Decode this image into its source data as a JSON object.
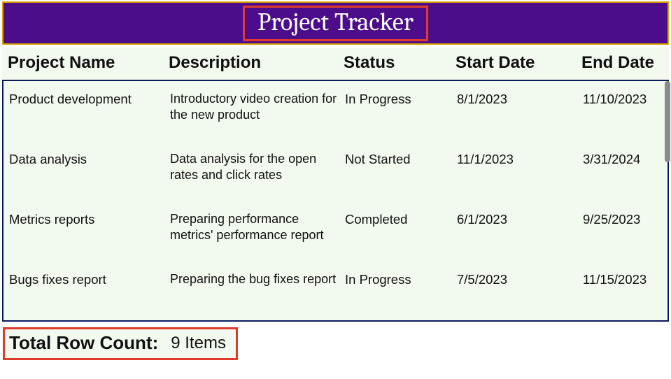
{
  "header": {
    "title": "Project Tracker"
  },
  "columns": {
    "name": "Project Name",
    "desc": "Description",
    "status": "Status",
    "start": "Start Date",
    "end": "End Date"
  },
  "rows": [
    {
      "name": "Product development",
      "desc": "Introductory video creation for the new product",
      "status": "In Progress",
      "start": "8/1/2023",
      "end": "11/10/2023"
    },
    {
      "name": "Data analysis",
      "desc": "Data analysis for the open rates and click rates",
      "status": "Not Started",
      "start": "11/1/2023",
      "end": "3/31/2024"
    },
    {
      "name": "Metrics reports",
      "desc": "Preparing performance metrics' performance report",
      "status": "Completed",
      "start": "6/1/2023",
      "end": "9/25/2023"
    },
    {
      "name": "Bugs fixes report",
      "desc": "Preparing the bug fixes report",
      "status": "In Progress",
      "start": "7/5/2023",
      "end": "11/15/2023"
    }
  ],
  "footer": {
    "label": "Total Row Count:",
    "value": "9 Items"
  }
}
